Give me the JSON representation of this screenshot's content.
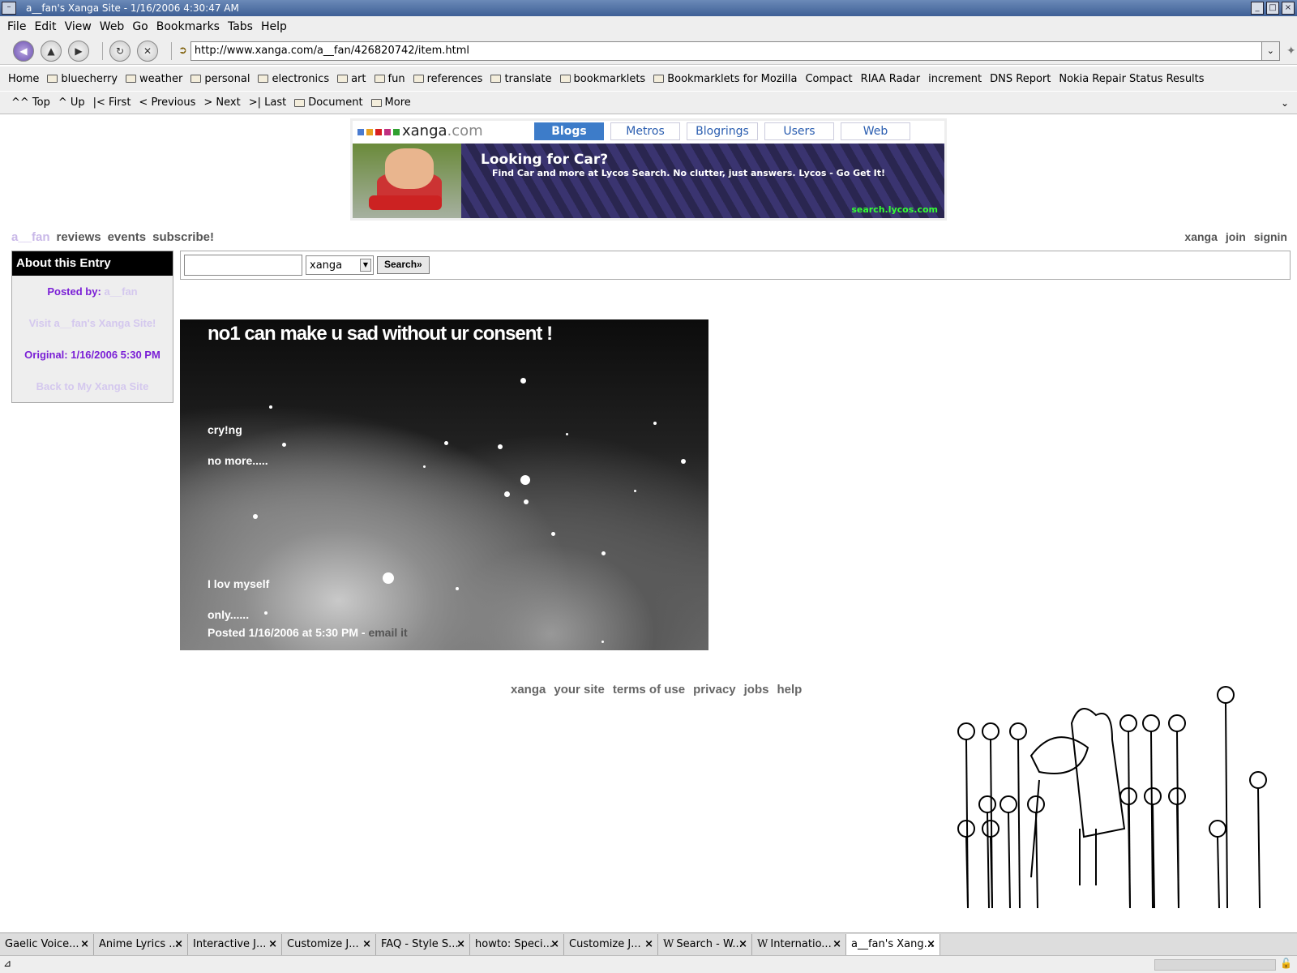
{
  "window": {
    "title": "a__fan's Xanga Site - 1/16/2006 4:30:47 AM"
  },
  "menu": [
    "File",
    "Edit",
    "View",
    "Web",
    "Go",
    "Bookmarks",
    "Tabs",
    "Help"
  ],
  "url": "http://www.xanga.com/a__fan/426820742/item.html",
  "bookmarks": [
    {
      "label": "Home",
      "folder": false
    },
    {
      "label": "bluecherry",
      "folder": true
    },
    {
      "label": "weather",
      "folder": true
    },
    {
      "label": "personal",
      "folder": true
    },
    {
      "label": "electronics",
      "folder": true
    },
    {
      "label": "art",
      "folder": true
    },
    {
      "label": "fun",
      "folder": true
    },
    {
      "label": "references",
      "folder": true
    },
    {
      "label": "translate",
      "folder": true
    },
    {
      "label": "bookmarklets",
      "folder": true
    },
    {
      "label": "Bookmarklets for Mozilla",
      "folder": true
    },
    {
      "label": "Compact",
      "folder": false
    },
    {
      "label": "RIAA Radar",
      "folder": false
    },
    {
      "label": "increment",
      "folder": false
    },
    {
      "label": "DNS Report",
      "folder": false
    },
    {
      "label": "Nokia Repair Status Results",
      "folder": false
    }
  ],
  "sitenav": [
    {
      "label": "^^ Top",
      "folder": false
    },
    {
      "label": "^ Up",
      "folder": false
    },
    {
      "label": "|< First",
      "folder": false
    },
    {
      "label": "< Previous",
      "folder": false
    },
    {
      "label": "> Next",
      "folder": false
    },
    {
      "label": ">| Last",
      "folder": false
    },
    {
      "label": "Document",
      "folder": true
    },
    {
      "label": "More",
      "folder": true
    }
  ],
  "xanga": {
    "logo_text": "xanga",
    "logo_suffix": ".com",
    "logo_colors": [
      "#4a7bd0",
      "#e8a020",
      "#d82020",
      "#c03080",
      "#30a030"
    ],
    "tabs": [
      "Blogs",
      "Metros",
      "Blogrings",
      "Users",
      "Web"
    ],
    "ad": {
      "headline": "Looking for Car?",
      "body": "Find Car and more at Lycos Search.  No clutter, just answers.  Lycos - Go Get It!",
      "domain": "search.lycos.com"
    }
  },
  "topnav": {
    "user": "a__fan",
    "links": [
      "reviews",
      "events",
      "subscribe!"
    ]
  },
  "topright": [
    "xanga",
    "join",
    "signin"
  ],
  "about": {
    "heading": "About this Entry",
    "posted_by_label": "Posted by:",
    "posted_by_user": "a__fan",
    "visit_link": "Visit a__fan's Xanga Site!",
    "original": "Original: 1/16/2006 5:30 PM",
    "back_link": "Back to My Xanga Site"
  },
  "search": {
    "select_value": "xanga",
    "button": "Search»"
  },
  "entry": {
    "title": "no1 can make u sad without ur consent !",
    "lines": [
      "cry!ng",
      "no more.....",
      "I lov myself",
      "only......"
    ],
    "posted": "Posted 1/16/2006 at 5:30 PM - ",
    "email": "email it"
  },
  "footer": [
    "xanga",
    "your site",
    "terms of use",
    "privacy",
    "jobs",
    "help"
  ],
  "tabs": [
    {
      "label": "Gaelic Voice...",
      "wiki": false
    },
    {
      "label": "Anime Lyrics ...",
      "wiki": false
    },
    {
      "label": "Interactive J...",
      "wiki": false
    },
    {
      "label": "Customize J...",
      "wiki": false
    },
    {
      "label": "FAQ - Style S...",
      "wiki": false
    },
    {
      "label": "howto: Speci...",
      "wiki": false
    },
    {
      "label": "Customize J...",
      "wiki": false
    },
    {
      "label": "Search - W...",
      "wiki": true
    },
    {
      "label": "Internatio...",
      "wiki": true
    },
    {
      "label": "a__fan's Xang...",
      "wiki": false,
      "active": true
    }
  ]
}
